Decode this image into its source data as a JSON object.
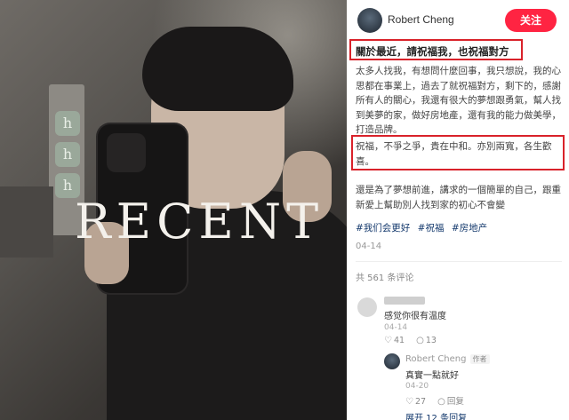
{
  "photo": {
    "overlay_text": "RECENT"
  },
  "header": {
    "author": "Robert Cheng",
    "follow_label": "关注"
  },
  "post": {
    "title": "關於最近，請祝福我，也祝福對方",
    "paragraphs": [
      "太多人找我，有想問什麼回事，我只想說，我的心思都在事業上，過去了就祝福對方，剩下的，感謝所有人的關心，我還有很大的夢想跟勇氣，幫人找到美夢的家，做好房地產，還有我的能力做美學，打造品牌。",
      "祝福，不爭之爭，貴在中和。亦別兩寬，各生歡喜。",
      "還是為了夢想前進，講求的一個簡單的自己，跟重新愛上幫助別人找到家的初心不會變"
    ],
    "tags": [
      "#我们会更好",
      "#祝福",
      "#房地产"
    ],
    "date": "04-14"
  },
  "comments_section": {
    "count_label": "共 561 条评论",
    "comments": [
      {
        "text": "感觉你很有温度",
        "date": "04-14",
        "likes": "41",
        "replies": "13",
        "reply": {
          "author": "Robert Cheng",
          "author_tag": "作者",
          "text": "真實一點就好",
          "date": "04-20",
          "likes": "27",
          "replies": "回复"
        }
      }
    ],
    "expand_label": "展开 12 条回复"
  },
  "colors": {
    "accent": "#ff2442",
    "highlight_border": "#d9222a",
    "tag": "#13386c"
  }
}
